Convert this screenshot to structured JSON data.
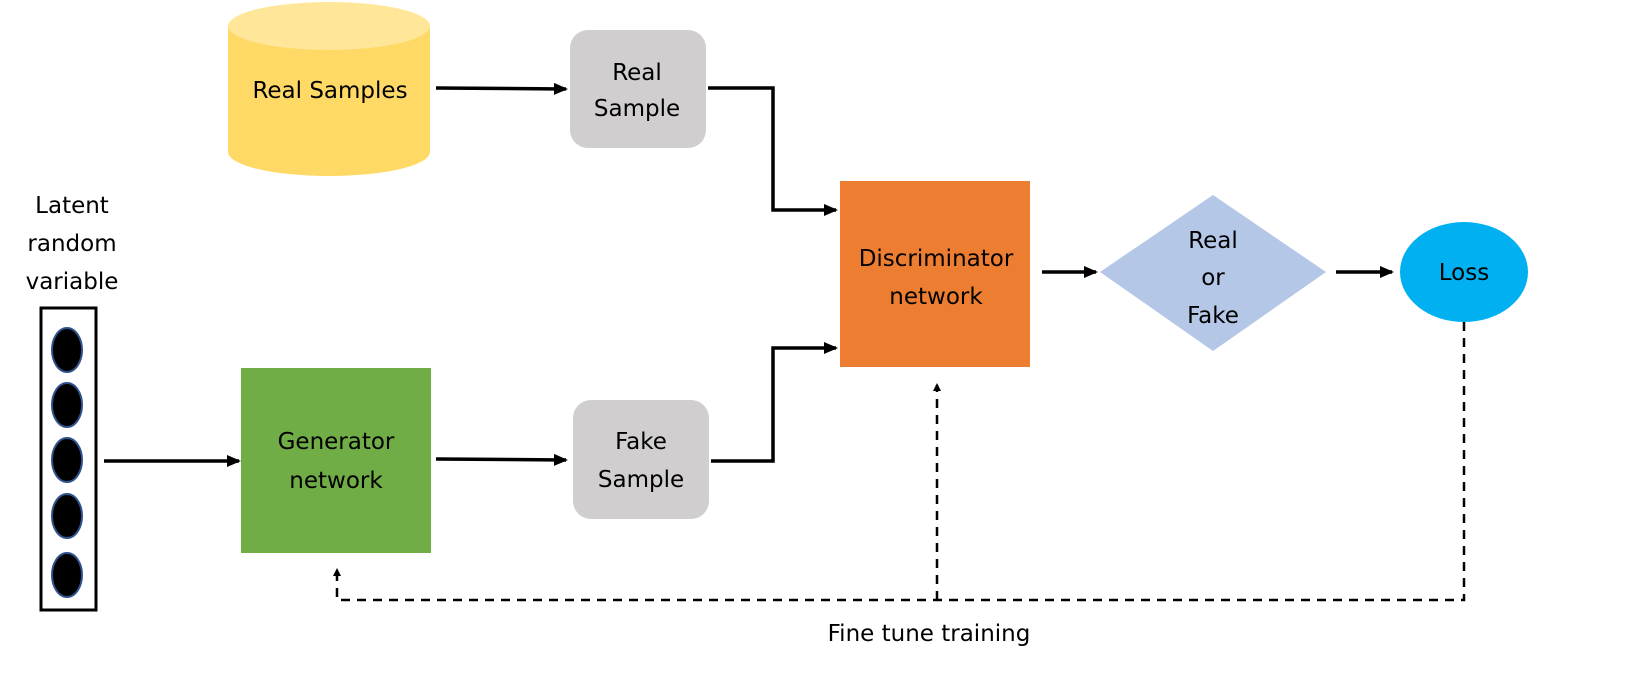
{
  "nodes": {
    "real_samples": {
      "label": "Real Samples",
      "color": "#FFD966"
    },
    "real_sample": {
      "lines": [
        "Real",
        "Sample"
      ],
      "color": "#D0CECE"
    },
    "latent": {
      "lines": [
        "Latent",
        "random",
        "variable"
      ]
    },
    "generator": {
      "lines": [
        "Generator",
        "network"
      ],
      "color": "#70AD47"
    },
    "fake_sample": {
      "lines": [
        "Fake",
        "Sample"
      ],
      "color": "#D0CECE"
    },
    "discriminator": {
      "lines": [
        "Discriminator",
        "network"
      ],
      "color": "#ED7D31"
    },
    "decision": {
      "lines": [
        "Real",
        "or",
        "Fake"
      ],
      "color": "#B4C7E7"
    },
    "loss": {
      "label": "Loss",
      "color": "#00B0F0"
    }
  },
  "feedback": {
    "label": "Fine tune training"
  }
}
